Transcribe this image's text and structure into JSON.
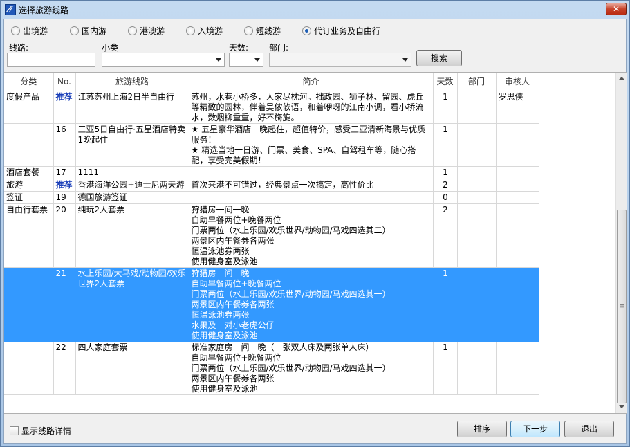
{
  "window": {
    "title": "选择旅游线路",
    "close": "✕"
  },
  "categories": [
    {
      "label": "出境游",
      "checked": false
    },
    {
      "label": "国内游",
      "checked": false
    },
    {
      "label": "港澳游",
      "checked": false
    },
    {
      "label": "入境游",
      "checked": false
    },
    {
      "label": "短线游",
      "checked": false
    },
    {
      "label": "代订业务及自由行",
      "checked": true
    }
  ],
  "filters": {
    "route_label": "线路:",
    "subclass_label": "小类",
    "days_label": "天数:",
    "dept_label": "部门:",
    "route_value": "",
    "subclass_value": "",
    "days_value": "",
    "dept_value": "",
    "search_button": "搜索"
  },
  "grid": {
    "columns": [
      "分类",
      "No.",
      "旅游线路",
      "简介",
      "天数",
      "部门",
      "审核人"
    ],
    "rows": [
      {
        "category": "度假产品",
        "no": "推荐",
        "route": "江苏苏州上海2日半自由行",
        "intro": "苏州，水巷小桥多，人家尽枕河。拙政园、狮子林、留园、虎丘等精致的园林，伴着吴侬软语，和着咿呀的江南小调，看小桥流水，数烟柳重重，好不旖旎。",
        "days": "1",
        "dept": "",
        "reviewer": "罗思侠",
        "selected": false
      },
      {
        "category": "",
        "no": "16",
        "route": "三亚5日自由行·五星酒店特卖1晚起住",
        "intro": "★ 五星豪华酒店一晚起住，超值特价，感受三亚清新海景与优质服务！\n★ 精选当地一日游、门票、美食、SPA、自驾租车等，随心搭配，享受完美假期！",
        "days": "1",
        "dept": "",
        "reviewer": "",
        "selected": false
      },
      {
        "category": "酒店套餐",
        "no": "17",
        "route": "1111",
        "intro": "",
        "days": "1",
        "dept": "",
        "reviewer": "",
        "selected": false
      },
      {
        "category": "旅游",
        "no": "推荐",
        "route": "香港海洋公园+迪士尼两天游",
        "intro": "首次来港不可错过，经典景点一次搞定，高性价比",
        "days": "2",
        "dept": "",
        "reviewer": "",
        "selected": false
      },
      {
        "category": "签证",
        "no": "19",
        "route": "德国旅游签证",
        "intro": "",
        "days": "0",
        "dept": "",
        "reviewer": "",
        "selected": false
      },
      {
        "category": "自由行套票",
        "no": "20",
        "route": "纯玩2人套票",
        "intro": "狩猎房一间一晚\n自助早餐两位+晚餐两位\n门票两位（水上乐园/欢乐世界/动物园/马戏四选其二）\n两景区内午餐券各两张\n恒温泳池券两张\n使用健身室及泳池",
        "days": "2",
        "dept": "",
        "reviewer": "",
        "selected": false
      },
      {
        "category": "",
        "no": "21",
        "route": "水上乐园/大马戏/动物园/欢乐世界2人套票",
        "intro": "狩猎房一间一晚\n自助早餐两位+晚餐两位\n门票两位（水上乐园/欢乐世界/动物园/马戏四选其一）\n两景区内午餐券各两张\n恒温泳池券两张\n水果及一对小老虎公仔\n使用健身室及泳池",
        "days": "1",
        "dept": "",
        "reviewer": "",
        "selected": true
      },
      {
        "category": "",
        "no": "22",
        "route": "四人家庭套票",
        "intro": "标准家庭房一间一晚（一张双人床及两张单人床）\n自助早餐两位+晚餐两位\n门票两位（水上乐园/欢乐世界/动物园/马戏四选其一）\n两景区内午餐券各两张\n使用健身室及泳池",
        "days": "1",
        "dept": "",
        "reviewer": "",
        "selected": false
      }
    ]
  },
  "footer": {
    "show_details_label": "显示线路详情",
    "show_details_checked": false,
    "sort_button": "排序",
    "next_button": "下一步",
    "exit_button": "退出"
  }
}
